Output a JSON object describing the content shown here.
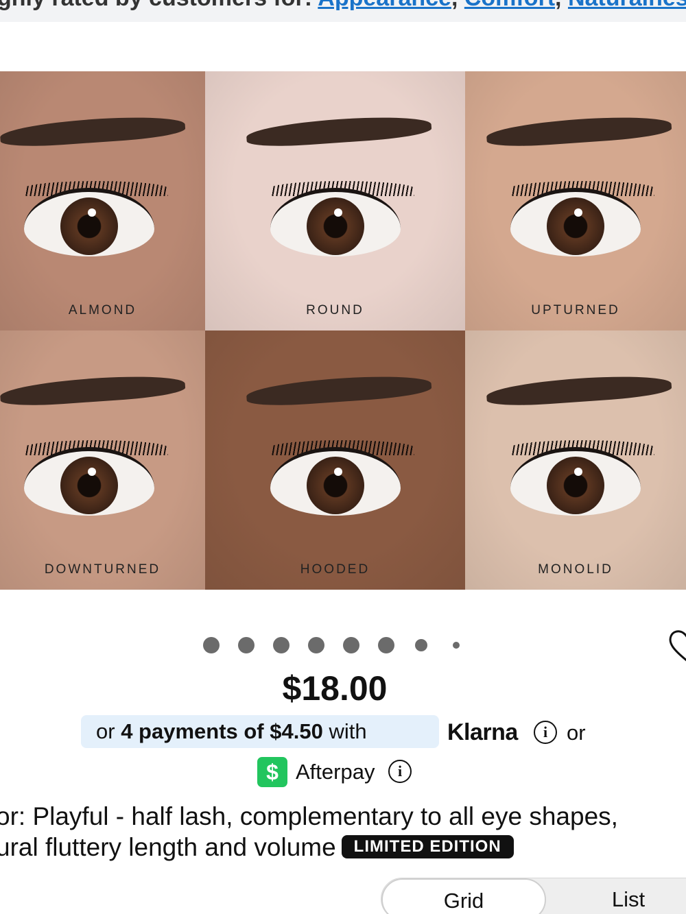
{
  "banner": {
    "prefix": "ghly rated by customers for: ",
    "links": [
      "Appearance",
      "Comfort",
      "Naturalness"
    ]
  },
  "gallery": {
    "tiles": [
      {
        "label": "ALMOND",
        "skin": "#b98873"
      },
      {
        "label": "ROUND",
        "skin": "#e9d2cb"
      },
      {
        "label": "UPTURNED",
        "skin": "#d4a88f"
      },
      {
        "label": "DOWNTURNED",
        "skin": "#c79a84"
      },
      {
        "label": "HOODED",
        "skin": "#8a5a42"
      },
      {
        "label": "MONOLID",
        "skin": "#dcc0ad"
      }
    ],
    "dots_total": 8
  },
  "product": {
    "price": "$18.00",
    "klarna": {
      "prefix": "or ",
      "bold": "4 payments of $4.50",
      "suffix": " with",
      "brand": "Klarna",
      "info": "i",
      "or": "or"
    },
    "afterpay": {
      "symbol": "$",
      "brand": "Afterpay",
      "info": "i"
    },
    "description_line1": "or: Playful - half lash, complementary to all eye shapes,",
    "description_line2": "ural fluttery length and volume",
    "badge": "LIMITED EDITION"
  },
  "view_toggle": {
    "grid_label": "Grid",
    "list_label": "List"
  },
  "colors": {
    "link": "#1a73c9",
    "klarna_bg": "#e4f0fb",
    "afterpay_green": "#22c55e"
  }
}
